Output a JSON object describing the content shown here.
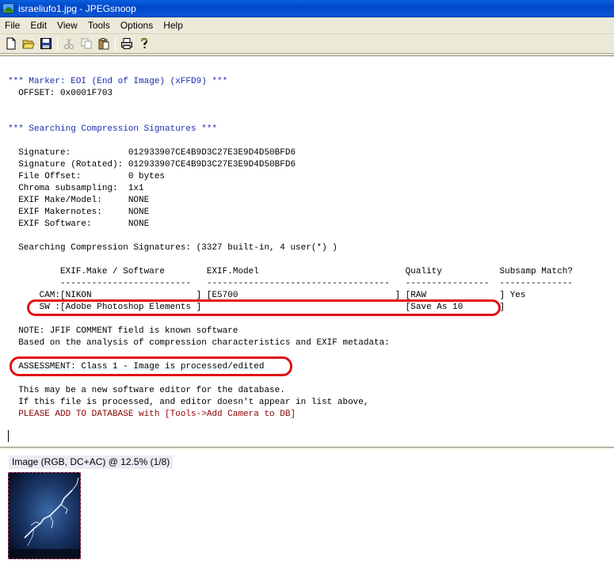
{
  "window": {
    "title": "israeliufo1.jpg - JPEGsnoop"
  },
  "menu": [
    "File",
    "Edit",
    "View",
    "Tools",
    "Options",
    "Help"
  ],
  "toolbar": {
    "buttons": [
      "new-icon",
      "open-folder-icon",
      "save-icon",
      "cut-icon",
      "copy-icon",
      "paste-icon",
      "print-icon",
      "help-icon"
    ]
  },
  "report": {
    "eoi_header": "*** Marker: EOI (End of Image) (xFFD9) ***",
    "eoi_offset": "  OFFSET: 0x0001F703",
    "sig_header": "*** Searching Compression Signatures ***",
    "sig_fields": [
      "  Signature:           012933907CE4B9D3C27E3E9D4D50BFD6",
      "  Signature (Rotated): 012933907CE4B9D3C27E3E9D4D50BFD6",
      "  File Offset:         0 bytes",
      "  Chroma subsampling:  1x1",
      "  EXIF Make/Model:     NONE",
      "  EXIF Makernotes:     NONE",
      "  EXIF Software:       NONE"
    ],
    "searching_line": "  Searching Compression Signatures: (3327 built-in, 4 user(*) )",
    "table_header": "          EXIF.Make / Software        EXIF.Model                            Quality           Subsamp Match?",
    "table_rule": "          -------------------------   -----------------------------------   ----------------  --------------",
    "cam_row": "      CAM:[NIKON                    ] [E5700                              ] [RAW              ] Yes",
    "sw_row": "      SW :[Adobe Photoshop Elements ]                                       [Save As 10       ]",
    "note_line": "  NOTE: JFIF COMMENT field is known software",
    "based_line": "  Based on the analysis of compression characteristics and EXIF metadata:",
    "assessment": "  ASSESSMENT: Class 1 - Image is processed/edited",
    "info_lines": [
      "  This may be a new software editor for the database.",
      "  If this file is processed, and editor doesn't appear in list above,"
    ],
    "add_db_line": "  PLEASE ADD TO DATABASE with [Tools->Add Camera to DB]"
  },
  "image_pane": {
    "label": "Image (RGB, DC+AC) @ 12.5% (1/8)"
  },
  "colors": {
    "marker_blue": "#1c2bb0",
    "highlight_red": "#e01010",
    "add_db_red": "#8b0000"
  }
}
